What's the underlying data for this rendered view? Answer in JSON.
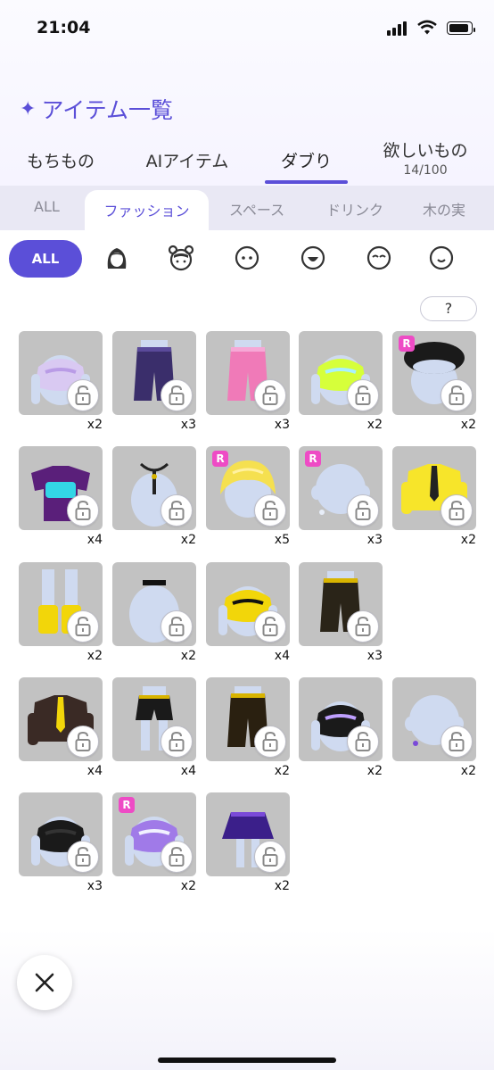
{
  "status": {
    "time": "21:04"
  },
  "header": {
    "title": "アイテム一覧"
  },
  "main_tabs": [
    {
      "label": "もちもの"
    },
    {
      "label": "AIアイテム"
    },
    {
      "label": "ダブり",
      "active": true
    },
    {
      "label": "欲しいもの",
      "sub": "14/100"
    }
  ],
  "category_tabs": [
    {
      "label": "ALL"
    },
    {
      "label": "ファッション",
      "active": true
    },
    {
      "label": "スペース"
    },
    {
      "label": "ドリンク"
    },
    {
      "label": "木の実"
    }
  ],
  "filters": {
    "all_label": "ALL",
    "icons": [
      "hair-icon",
      "head-accessory-icon",
      "eyes-icon",
      "mouth-open-icon",
      "eyes-closed-icon",
      "face-icon"
    ]
  },
  "help_label": "?",
  "items": [
    {
      "count": "x2",
      "rare": false,
      "kind": "top",
      "color": "#d9c9f2",
      "accent": "#b99be6"
    },
    {
      "count": "x3",
      "rare": false,
      "kind": "pants",
      "color": "#3a2e6b",
      "accent": "#5a4a9a"
    },
    {
      "count": "x3",
      "rare": false,
      "kind": "pants",
      "color": "#f07ab8",
      "accent": "#f6a8d6"
    },
    {
      "count": "x2",
      "rare": false,
      "kind": "top",
      "color": "#d6ff3a",
      "accent": "#a8f0ff"
    },
    {
      "count": "x2",
      "rare": true,
      "kind": "hat",
      "color": "#1a1a1a",
      "accent": "#333333"
    },
    {
      "count": "x4",
      "rare": false,
      "kind": "tshirt",
      "color": "#5a1f7a",
      "accent": "#33d6e6"
    },
    {
      "count": "x2",
      "rare": false,
      "kind": "necklace",
      "color": "#ffffff",
      "accent": "#222222"
    },
    {
      "count": "x5",
      "rare": true,
      "kind": "hair",
      "color": "#f5e050",
      "accent": "#fff1a0"
    },
    {
      "count": "x3",
      "rare": true,
      "kind": "head",
      "color": "#cfdaf0",
      "accent": "#e8eef9"
    },
    {
      "count": "x2",
      "rare": false,
      "kind": "jacket",
      "color": "#f7e52a",
      "accent": "#222222"
    },
    {
      "count": "x2",
      "rare": false,
      "kind": "boots",
      "color": "#f2d60a",
      "accent": "#cfdaf0"
    },
    {
      "count": "x2",
      "rare": false,
      "kind": "choker",
      "color": "#cfdaf0",
      "accent": "#111111"
    },
    {
      "count": "x4",
      "rare": false,
      "kind": "top",
      "color": "#f2d60a",
      "accent": "#111111"
    },
    {
      "count": "x3",
      "rare": false,
      "kind": "pants",
      "color": "#2a2418",
      "accent": "#d8b400"
    },
    {
      "count": "x4",
      "rare": false,
      "kind": "jacket",
      "color": "#3a2a25",
      "accent": "#f2d60a"
    },
    {
      "count": "x4",
      "rare": false,
      "kind": "shorts",
      "color": "#1a1a1a",
      "accent": "#d8b400"
    },
    {
      "count": "x2",
      "rare": false,
      "kind": "pants",
      "color": "#2a2010",
      "accent": "#d8b400"
    },
    {
      "count": "x2",
      "rare": false,
      "kind": "top",
      "color": "#1a1a1a",
      "accent": "#bfa0ff"
    },
    {
      "count": "x2",
      "rare": false,
      "kind": "head",
      "color": "#cfdaf0",
      "accent": "#7a4ad8"
    },
    {
      "count": "x3",
      "rare": false,
      "kind": "top",
      "color": "#1a1a1a",
      "accent": "#333333"
    },
    {
      "count": "x2",
      "rare": true,
      "kind": "top",
      "color": "#a07ae8",
      "accent": "#f2f2ff"
    },
    {
      "count": "x2",
      "rare": false,
      "kind": "skirt",
      "color": "#3b1f8a",
      "accent": "#7a4ad8"
    }
  ]
}
